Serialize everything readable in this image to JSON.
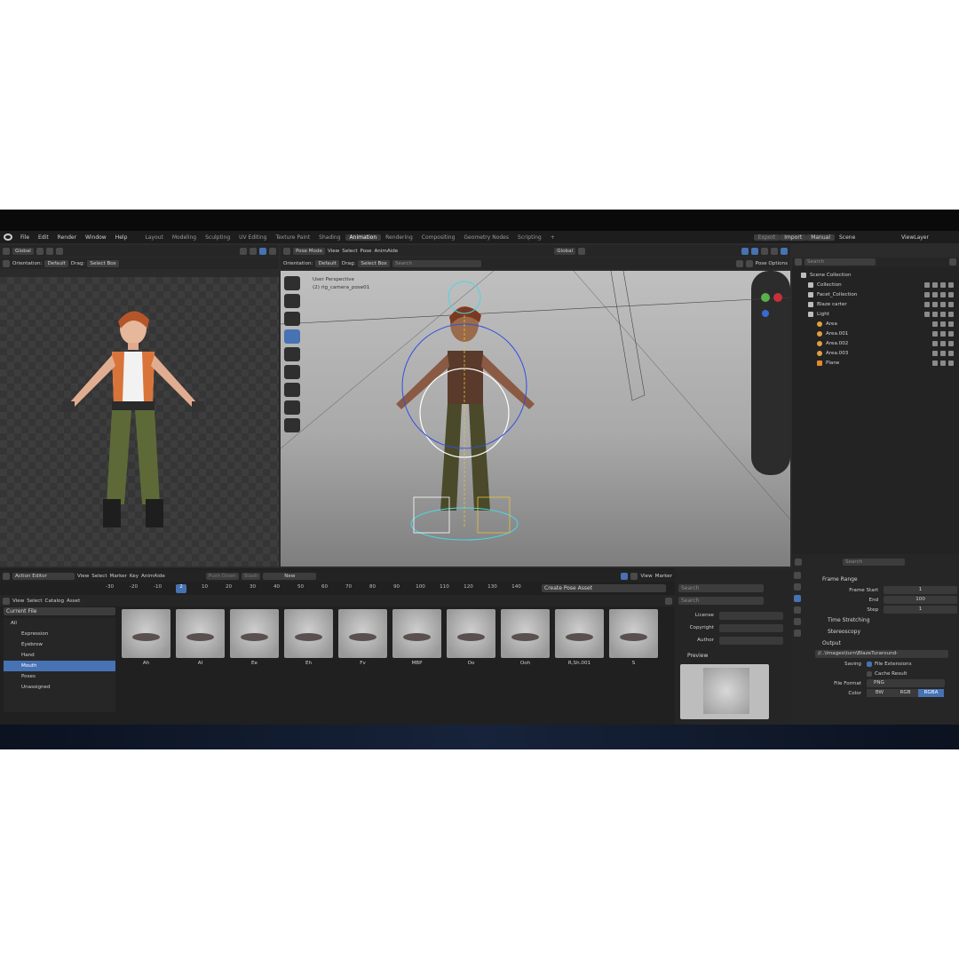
{
  "menubar": {
    "items": [
      "File",
      "Edit",
      "Render",
      "Window",
      "Help"
    ],
    "workspaces": [
      "Layout",
      "Modeling",
      "Sculpting",
      "UV Editing",
      "Texture Paint",
      "Shading",
      "Animation",
      "Rendering",
      "Compositing",
      "Geometry Nodes",
      "Scripting"
    ],
    "active_workspace": "Animation",
    "add": "+",
    "right": {
      "export": "Export",
      "import": "Import",
      "manual": "Manual",
      "scene": "Scene",
      "view_layer": "ViewLayer"
    }
  },
  "left_viewport": {
    "header": {
      "transform": "Global",
      "orientation_label": "Orientation:",
      "orientation": "Default",
      "drag_label": "Drag:",
      "drag": "Select Box"
    }
  },
  "main_viewport": {
    "header": {
      "mode": "Pose Mode",
      "menus": [
        "View",
        "Select",
        "Pose",
        "AnimAide"
      ],
      "transform": "Global",
      "orientation_label": "Orientation:",
      "orientation": "Default",
      "drag_label": "Drag:",
      "drag": "Select Box",
      "search_placeholder": "Search",
      "pose_options": "Pose Options"
    },
    "overlay": {
      "line1": "User Perspective",
      "line2": "(2) rig_camera_pose01"
    }
  },
  "outliner": {
    "search_placeholder": "Search",
    "items": [
      {
        "label": "Scene Collection",
        "indent": 0
      },
      {
        "label": "Collection",
        "indent": 1
      },
      {
        "label": "Facet_Collection",
        "indent": 1
      },
      {
        "label": "Blaze carter",
        "indent": 1
      },
      {
        "label": "Light",
        "indent": 1
      },
      {
        "label": "Area",
        "indent": 2
      },
      {
        "label": "Area.001",
        "indent": 2
      },
      {
        "label": "Area.002",
        "indent": 2
      },
      {
        "label": "Area.003",
        "indent": 2
      },
      {
        "label": "Plane",
        "indent": 2
      }
    ]
  },
  "action_editor": {
    "header": {
      "editor": "Action Editor",
      "menus": [
        "View",
        "Select",
        "Marker",
        "Key",
        "AnimAide"
      ],
      "push_down": "Push Down",
      "stash": "Stash",
      "new": "New",
      "right_menus": [
        "View",
        "Marker"
      ]
    },
    "timeline": [
      "-30",
      "-20",
      "-10",
      "2",
      "10",
      "20",
      "30",
      "40",
      "50",
      "60",
      "70",
      "80",
      "90",
      "100",
      "110",
      "120",
      "130",
      "140"
    ],
    "current_frame": "2",
    "asset_header": {
      "menus": [
        "View",
        "Select",
        "Catalog",
        "Asset"
      ],
      "create_pose": "Create Pose Asset",
      "search_placeholder": "Search"
    },
    "library": "Current File",
    "catalogs": [
      "All",
      "Expression",
      "Eyebrow",
      "Hand",
      "Mouth",
      "Poses",
      "Unassigned"
    ],
    "selected_catalog": "Mouth",
    "assets": [
      "Ah",
      "AI",
      "Ee",
      "Eh",
      "Fv",
      "MBP",
      "Oo",
      "Ooh",
      "R,Sh.001",
      "S"
    ]
  },
  "asset_side": {
    "search_placeholder": "Search",
    "fields": [
      "License",
      "Copyright",
      "Author"
    ],
    "preview_label": "Preview"
  },
  "properties": {
    "search_placeholder": "Search",
    "frame_range": {
      "title": "Frame Range",
      "start_label": "Frame Start",
      "start": "1",
      "end_label": "End",
      "end": "100",
      "step_label": "Step",
      "step": "1"
    },
    "time_stretching": "Time Stretching",
    "stereoscopy": "Stereoscopy",
    "output": {
      "title": "Output",
      "path": "//..\\Images\\turn\\BlazeTuraround-",
      "saving_label": "Saving",
      "file_ext": "File Extensions",
      "cache": "Cache Result",
      "format_label": "File Format",
      "format": "PNG",
      "color_label": "Color",
      "colors": [
        "BW",
        "RGB",
        "RGBA"
      ],
      "active_color": "RGBA"
    }
  },
  "accent": "#4772b3"
}
